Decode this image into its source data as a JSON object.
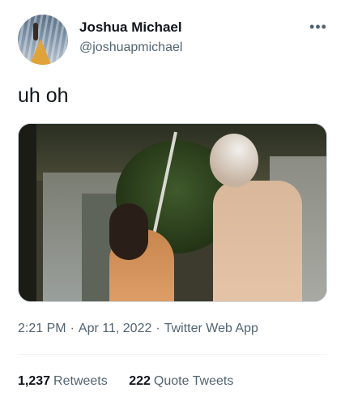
{
  "tweet": {
    "author": {
      "name": "Joshua Michael",
      "handle": "@joshuapmichael",
      "avatar_icon": "avatar-image"
    },
    "more_icon": "more-horizontal-icon",
    "text": "uh oh",
    "media": {
      "type": "video-still"
    },
    "meta": {
      "time": "2:21 PM",
      "separator": "·",
      "date": "Apr 11, 2022",
      "source": "Twitter Web App"
    },
    "stats": [
      {
        "count": "1,237",
        "label": "Retweets"
      },
      {
        "count": "222",
        "label": "Quote Tweets"
      }
    ]
  },
  "colors": {
    "text_primary": "#0f1419",
    "text_secondary": "#536471",
    "divider": "#eff3f4",
    "media_border": "#cfd9de"
  }
}
